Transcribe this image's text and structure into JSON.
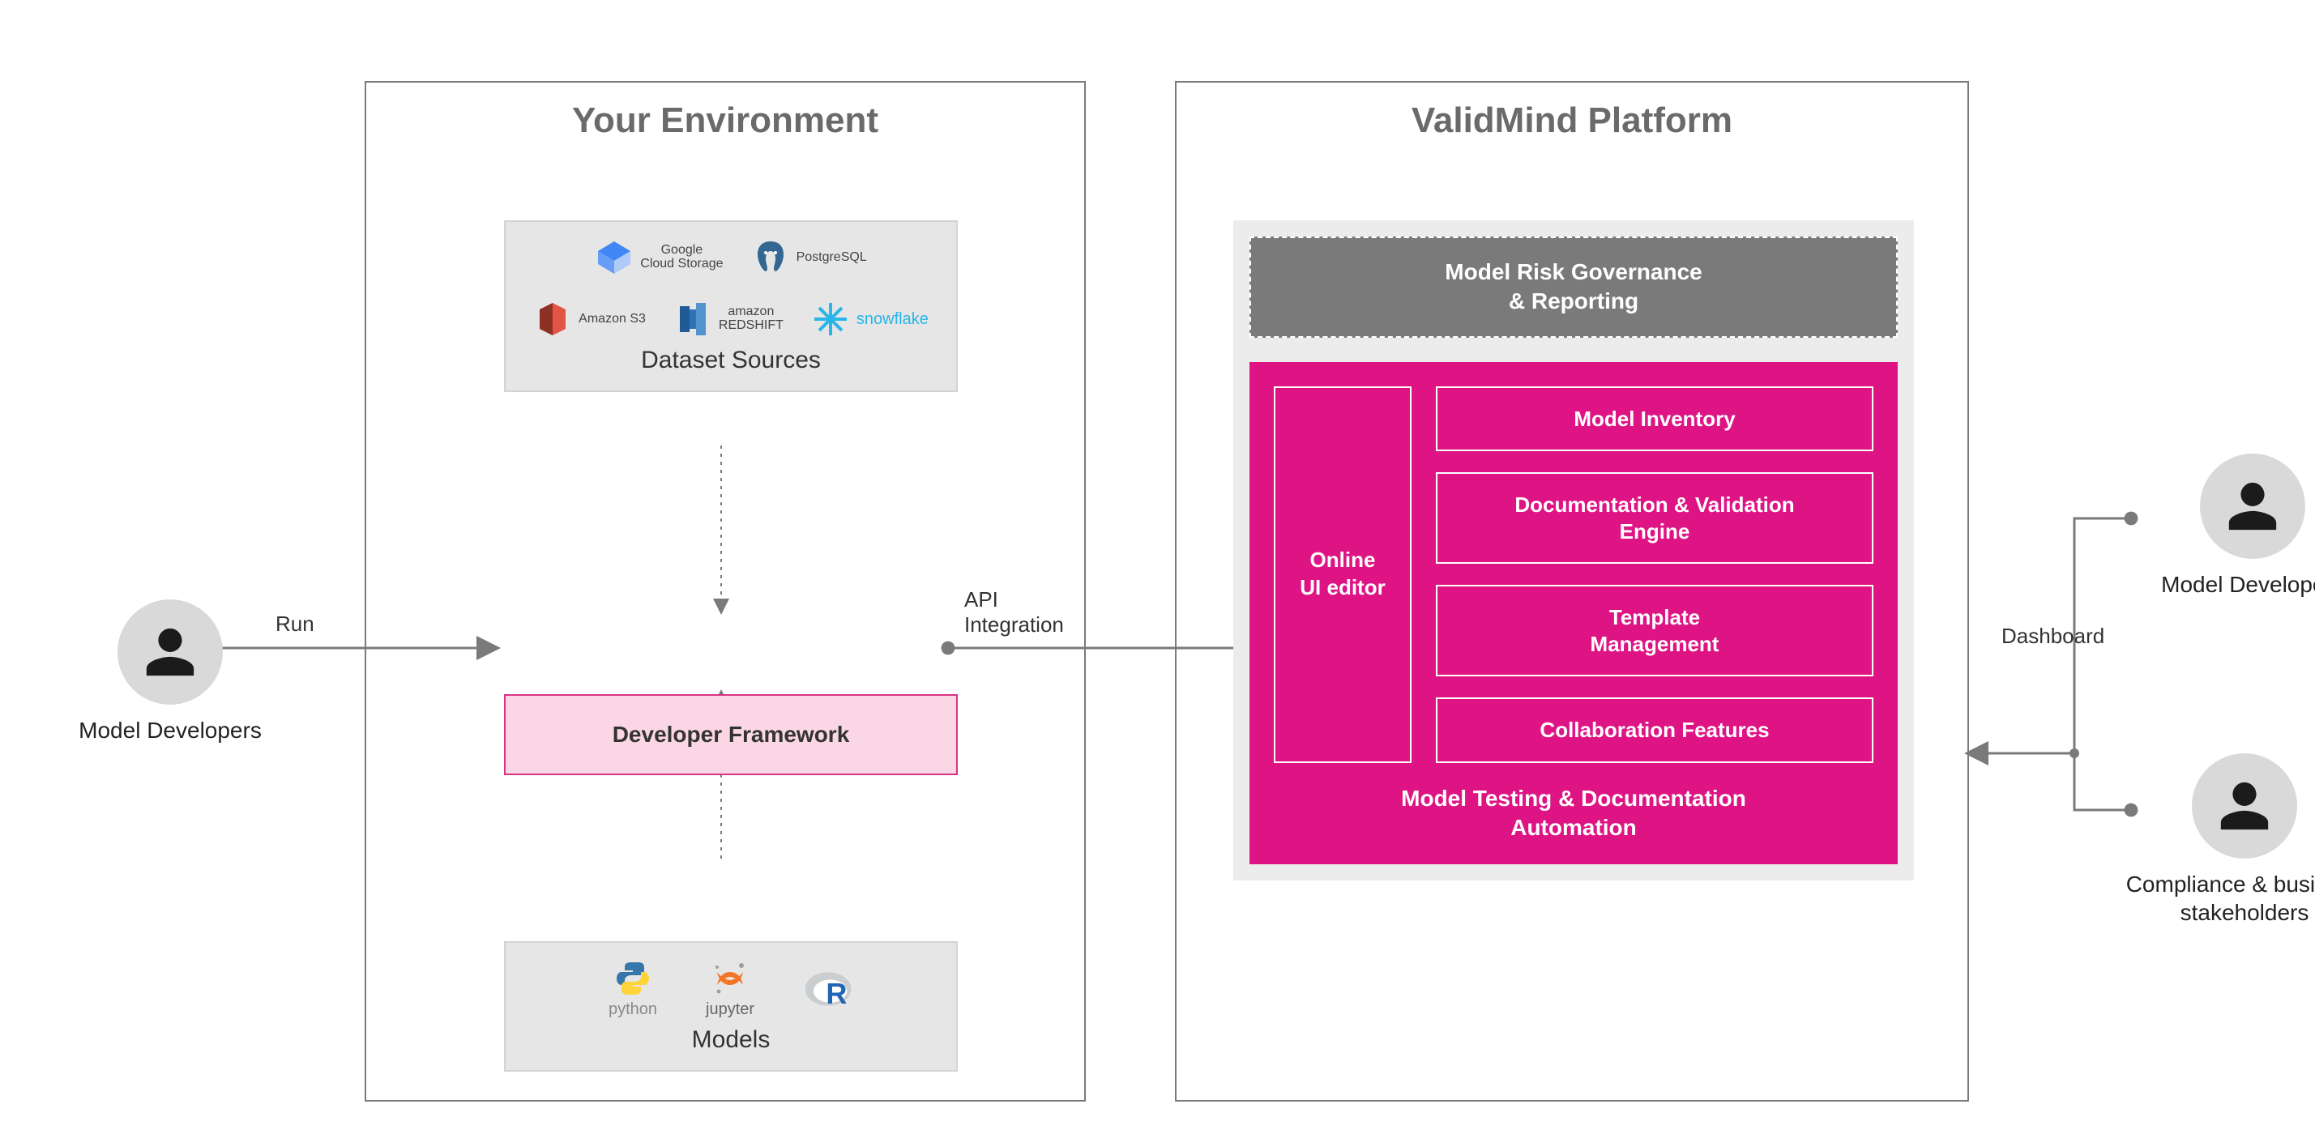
{
  "actors": {
    "left": {
      "label": "Model Developers"
    },
    "right_top": {
      "label": "Model Developers"
    },
    "right_bottom": {
      "label": "Compliance & business\nstakeholders"
    }
  },
  "edges": {
    "run": "Run",
    "api": "API\nIntegration",
    "dashboard": "Dashboard"
  },
  "environment": {
    "title": "Your Environment",
    "datasets": {
      "title": "Dataset Sources",
      "logos": {
        "gcs": "Google\nCloud Storage",
        "postgres": "PostgreSQL",
        "s3": "Amazon S3",
        "redshift": "amazon\nREDSHIFT",
        "snowflake": "snowflake"
      }
    },
    "dev_framework": "Developer Framework",
    "models": {
      "title": "Models",
      "logos": {
        "python": "python",
        "jupyter": "jupyter",
        "r": "R"
      }
    }
  },
  "platform": {
    "title": "ValidMind Platform",
    "governance": "Model Risk Governance\n& Reporting",
    "ui_editor": "Online\nUI editor",
    "items": [
      "Model Inventory",
      "Documentation & Validation\nEngine",
      "Template\nManagement",
      "Collaboration Features"
    ],
    "footer": "Model Testing & Documentation\nAutomation"
  }
}
